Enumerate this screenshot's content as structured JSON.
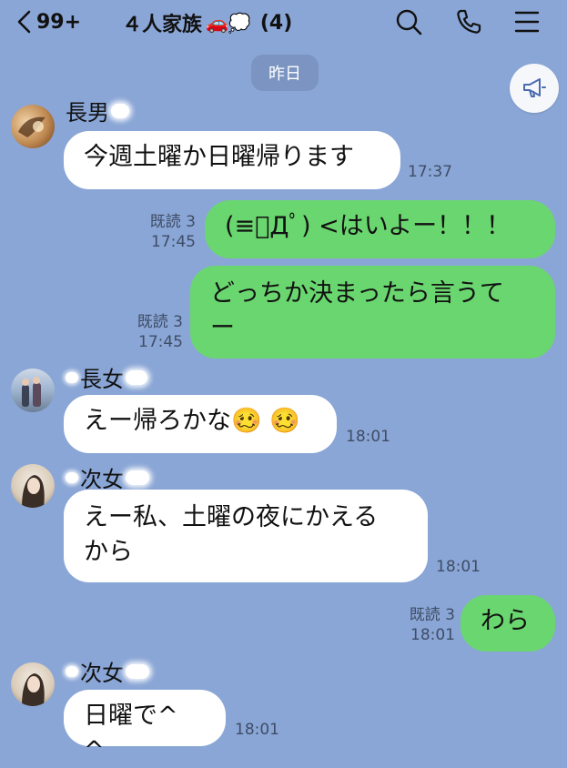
{
  "header": {
    "back_count": "99+",
    "title": "４人家族",
    "title_emoji": "🚗💭",
    "member_count": "(4)"
  },
  "date_divider": "昨日",
  "messages": [
    {
      "sender": "長男",
      "text": "今週土曜か日曜帰ります",
      "time": "17:37"
    },
    {
      "read": "既読 3",
      "text": "(≡ﾟДﾟ) <はいよー！！！",
      "time": "17:45"
    },
    {
      "read": "既読 3",
      "text_line1": "どっちか決まったら言うて",
      "text_line2": "ー",
      "time": "17:45"
    },
    {
      "sender": "長女",
      "text": "えー帰ろかな🥴 🥴",
      "time": "18:01"
    },
    {
      "sender": "次女",
      "text_line1": "えー私、土曜の夜にかえる",
      "text_line2": "から",
      "time": "18:01"
    },
    {
      "read": "既読 3",
      "text": "わら",
      "time": "18:01"
    },
    {
      "sender": "次女",
      "text": "日曜で^ ^",
      "time": "18:01"
    }
  ],
  "colors": {
    "background": "#8aa6d6",
    "bubble_out": "#6ad66f",
    "bubble_in": "#ffffff"
  }
}
